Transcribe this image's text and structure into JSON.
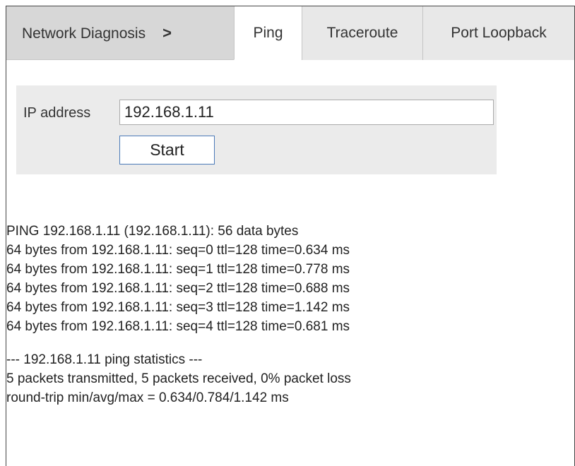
{
  "breadcrumb": {
    "label": "Network Diagnosis",
    "separator": ">"
  },
  "tabs": [
    {
      "label": "Ping",
      "active": true
    },
    {
      "label": "Traceroute",
      "active": false
    },
    {
      "label": "Port Loopback",
      "active": false
    }
  ],
  "form": {
    "ip_label": "IP address",
    "ip_value": "192.168.1.11",
    "start_label": "Start"
  },
  "output": {
    "header": "PING 192.168.1.11 (192.168.1.11): 56 data bytes",
    "replies": [
      "64 bytes from 192.168.1.11: seq=0 ttl=128 time=0.634 ms",
      "64 bytes from 192.168.1.11: seq=1 ttl=128 time=0.778 ms",
      "64 bytes from 192.168.1.11: seq=2 ttl=128 time=0.688 ms",
      "64 bytes from 192.168.1.11: seq=3 ttl=128 time=1.142 ms",
      "64 bytes from 192.168.1.11: seq=4 ttl=128 time=0.681 ms"
    ],
    "stats_header": "--- 192.168.1.11 ping statistics ---",
    "stats_packets": "5 packets transmitted, 5 packets received, 0% packet loss",
    "stats_rtt": "round-trip min/avg/max = 0.634/0.784/1.142 ms"
  },
  "colors": {
    "tabbar_bg": "#d7d7d7",
    "panel_bg": "#ebebeb",
    "button_border": "#4a7ab8"
  }
}
